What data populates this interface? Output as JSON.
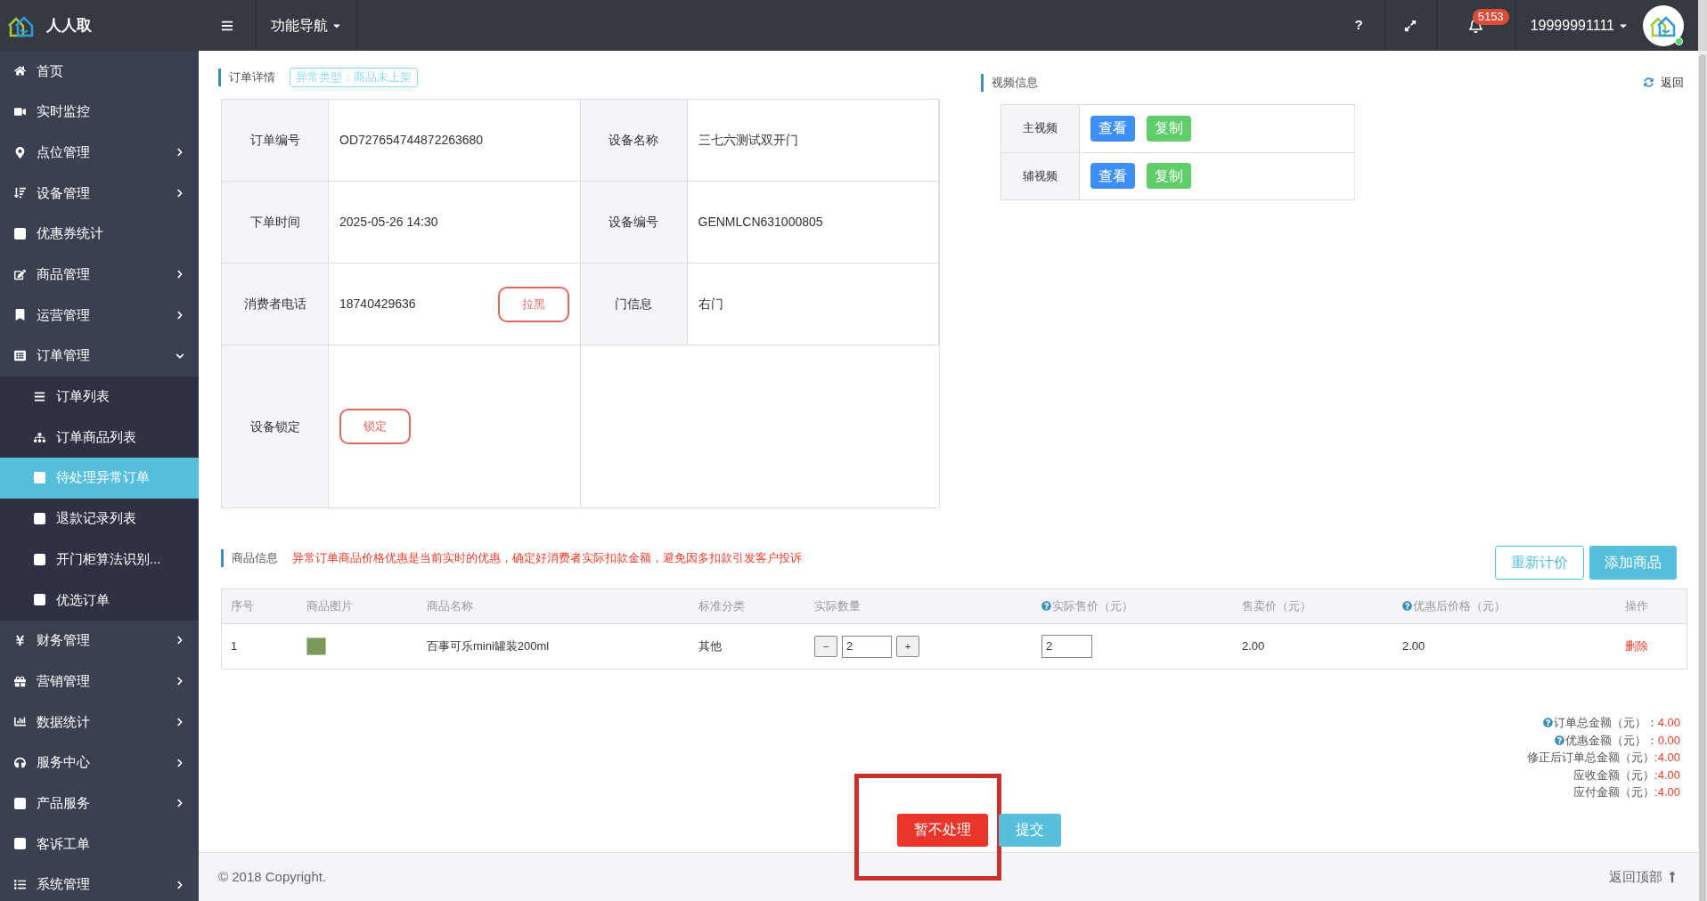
{
  "app": {
    "name": "人人取"
  },
  "header": {
    "nav_menu": "功能导航",
    "help": "?",
    "notifications": "5153",
    "user": "19999991111"
  },
  "sidebar": [
    {
      "label": "首页",
      "kind": "link",
      "selected": false
    },
    {
      "label": "实时监控",
      "kind": "link",
      "selected": false
    },
    {
      "label": "点位管理",
      "kind": "menu",
      "expanded": false,
      "selected": false
    },
    {
      "label": "设备管理",
      "kind": "menu",
      "expanded": false,
      "selected": false
    },
    {
      "label": "优惠券统计",
      "kind": "link",
      "selected": false
    },
    {
      "label": "商品管理",
      "kind": "menu",
      "expanded": false,
      "selected": false
    },
    {
      "label": "运营管理",
      "kind": "menu",
      "expanded": false,
      "selected": false
    },
    {
      "label": "订单管理",
      "kind": "menu",
      "expanded": true,
      "selected": false,
      "children": [
        {
          "label": "订单列表",
          "selected": false
        },
        {
          "label": "订单商品列表",
          "selected": false
        },
        {
          "label": "待处理异常订单",
          "selected": true
        },
        {
          "label": "退款记录列表",
          "selected": false
        },
        {
          "label": "开门柜算法识别...",
          "selected": false
        },
        {
          "label": "优选订单",
          "selected": false
        }
      ]
    },
    {
      "label": "财务管理",
      "kind": "menu",
      "expanded": false,
      "selected": false
    },
    {
      "label": "营销管理",
      "kind": "menu",
      "expanded": false,
      "selected": false
    },
    {
      "label": "数据统计",
      "kind": "menu",
      "expanded": false,
      "selected": false
    },
    {
      "label": "服务中心",
      "kind": "menu",
      "expanded": false,
      "selected": false
    },
    {
      "label": "产品服务",
      "kind": "menu",
      "expanded": false,
      "selected": false
    },
    {
      "label": "客诉工单",
      "kind": "link",
      "selected": false
    },
    {
      "label": "系统管理",
      "kind": "menu",
      "expanded": false,
      "selected": false
    }
  ],
  "order_detail": {
    "title": "订单详情",
    "anomaly_tag": "异常类型：商品未上架",
    "rows": [
      [
        {
          "label": "订单编号",
          "value": "OD727654744872263680"
        },
        {
          "label": "设备名称",
          "value": "三七六测试双开门"
        }
      ],
      [
        {
          "label": "下单时间",
          "value": "2025-05-26 14:30"
        },
        {
          "label": "设备编号",
          "value": "GENMLCN631000805"
        }
      ],
      [
        {
          "label": "消费者电话",
          "value": "18740429636",
          "button": "拉黑"
        },
        {
          "label": "门信息",
          "value": "右门"
        }
      ],
      [
        {
          "label": "设备锁定",
          "button": "锁定"
        }
      ]
    ]
  },
  "video": {
    "title": "视频信息",
    "back": "返回",
    "rows": [
      {
        "label": "主视频",
        "view": "查看",
        "copy": "复制"
      },
      {
        "label": "辅视频",
        "view": "查看",
        "copy": "复制"
      }
    ]
  },
  "products": {
    "title": "商品信息",
    "warning": "异常订单商品价格优惠是当前实时的优惠，确定好消费者实际扣款金额，避免因多扣款引发客户投诉",
    "buttons": [
      {
        "label": "重新计价",
        "kind": "outline"
      },
      {
        "label": "添加商品",
        "kind": "solid"
      }
    ],
    "columns": [
      {
        "label": "序号",
        "help": false
      },
      {
        "label": "商品图片",
        "help": false
      },
      {
        "label": "商品名称",
        "help": false
      },
      {
        "label": "标准分类",
        "help": false
      },
      {
        "label": "实际数量",
        "help": false
      },
      {
        "label": "实际售价（元）",
        "help": true
      },
      {
        "label": "售卖价（元）",
        "help": false
      },
      {
        "label": "优惠后价格（元）",
        "help": true
      },
      {
        "label": "操作",
        "help": false
      }
    ],
    "rows": [
      {
        "index": "1",
        "name": "百事可乐mini罐装200ml",
        "category": "其他",
        "minus": "−",
        "quantity": "2",
        "plus": "+",
        "actual_price": "2",
        "sale_price": "2.00",
        "discounted_price": "2.00",
        "action": "删除"
      }
    ]
  },
  "totals": [
    {
      "label": "订单总金额（元）：",
      "value": "4.00",
      "help": true
    },
    {
      "label": "优惠金额（元）：",
      "value": "0.00",
      "help": true
    },
    {
      "label": "修正后订单总金额（元）:",
      "value": "4.00",
      "help": false
    },
    {
      "label": "应收金额（元）:",
      "value": "4.00",
      "help": false
    },
    {
      "label": "应付金额（元）:",
      "value": "4.00",
      "help": false
    }
  ],
  "actions": [
    {
      "label": "暂不处理",
      "kind": "danger",
      "highlighted": true
    },
    {
      "label": "提交",
      "kind": "primary",
      "highlighted": false
    }
  ],
  "footer": {
    "copyright": "© 2018 Copyright.",
    "back_to_top": "返回顶部"
  }
}
